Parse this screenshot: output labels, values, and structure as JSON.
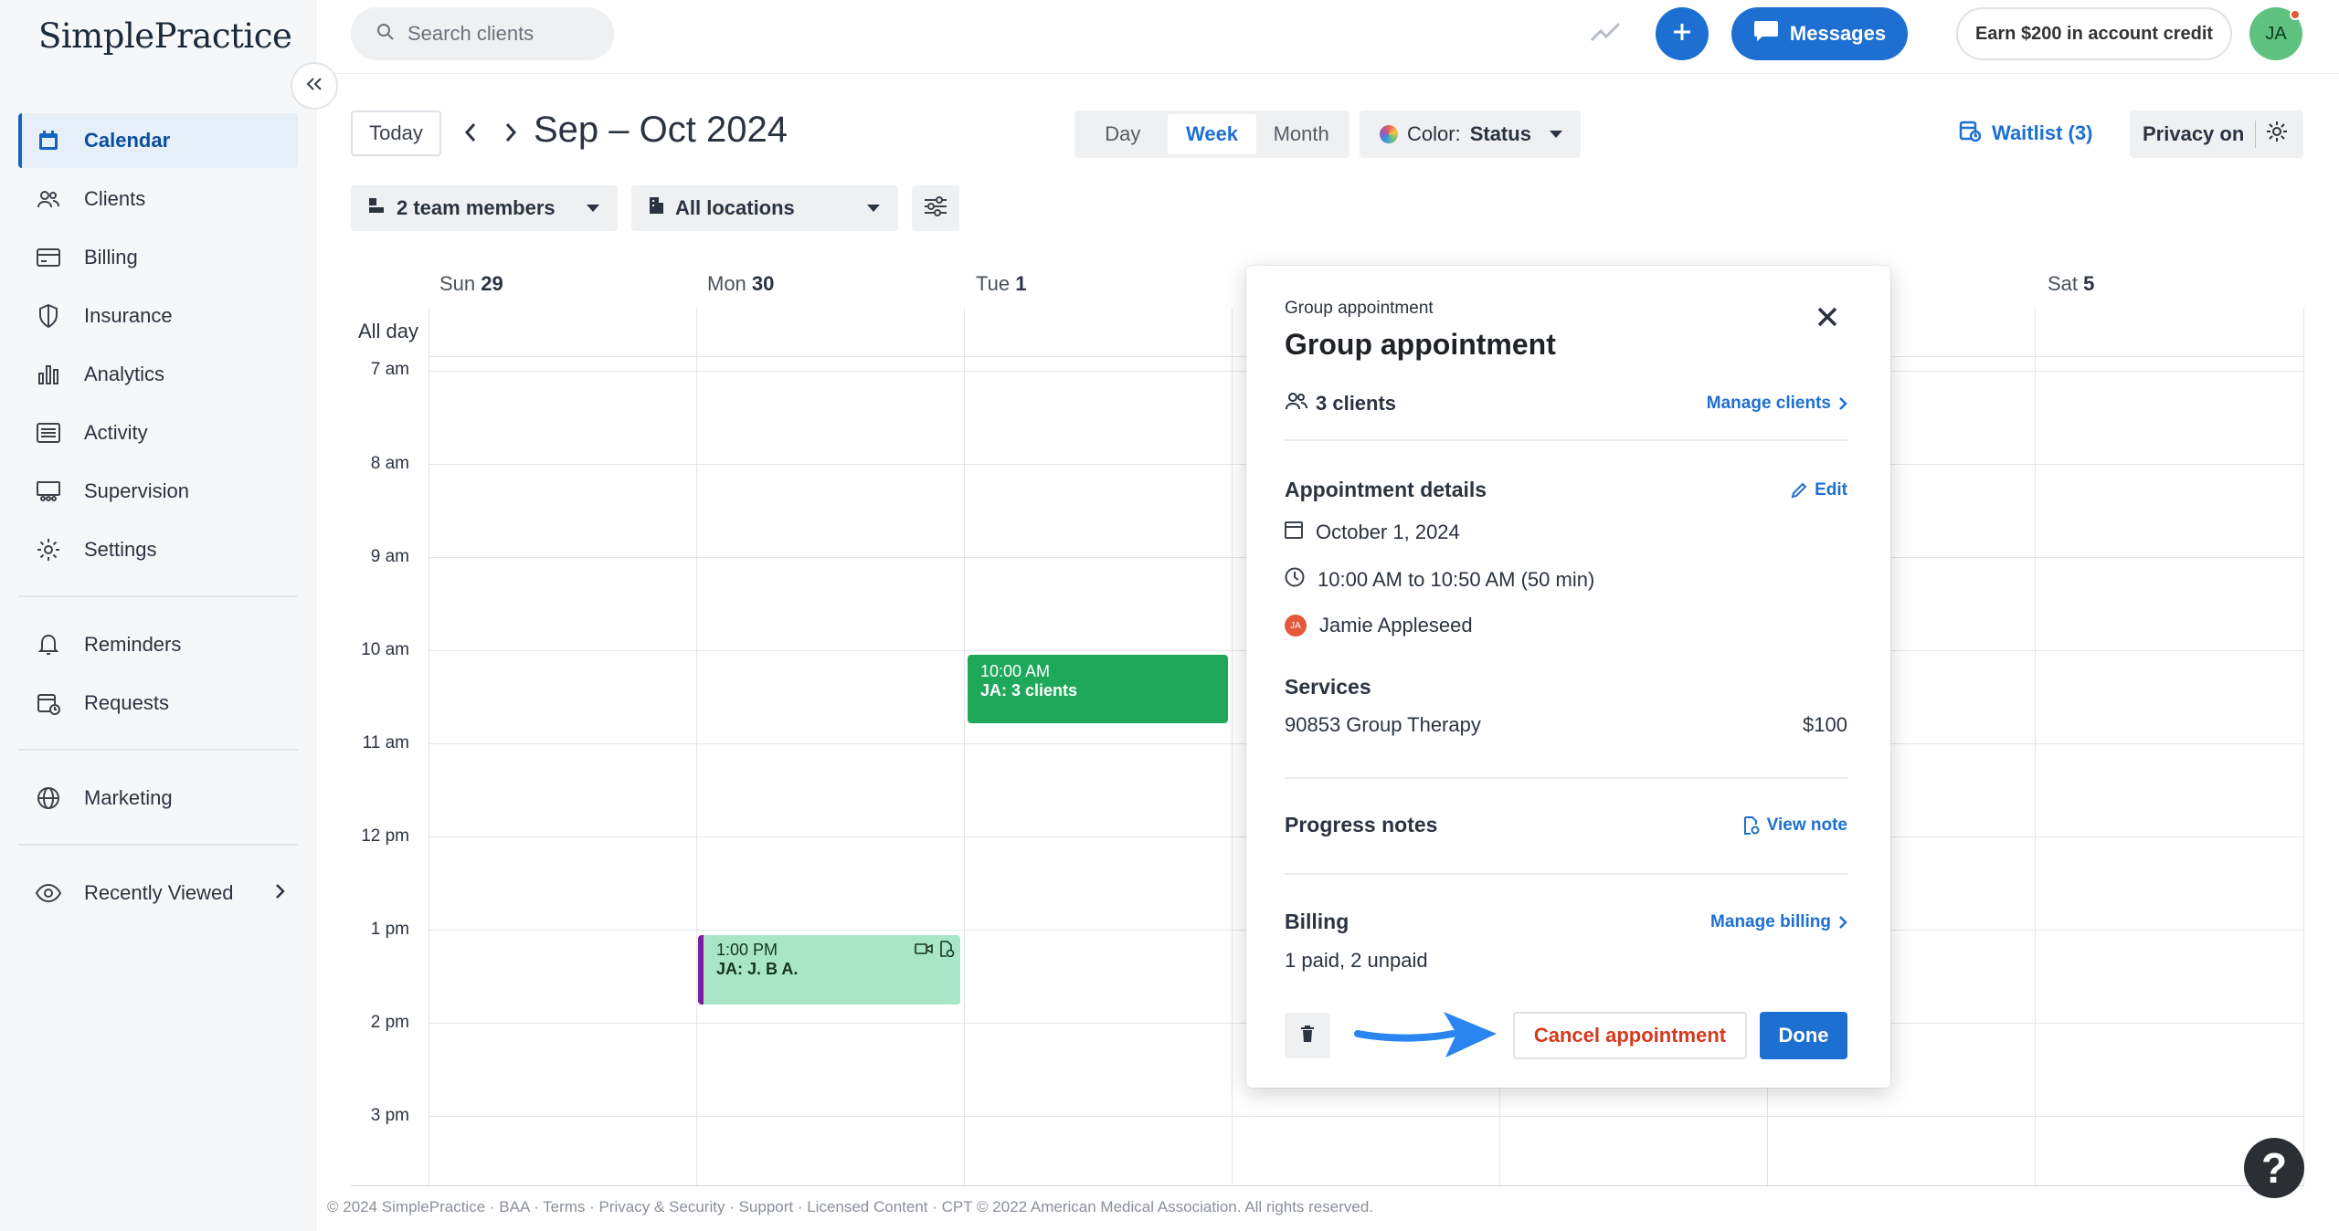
{
  "app": {
    "logo": "SimplePractice"
  },
  "sidebar": {
    "items": [
      {
        "label": "Calendar",
        "icon": "calendar-icon"
      },
      {
        "label": "Clients",
        "icon": "clients-icon"
      },
      {
        "label": "Billing",
        "icon": "billing-icon"
      },
      {
        "label": "Insurance",
        "icon": "shield-icon"
      },
      {
        "label": "Analytics",
        "icon": "bar-chart-icon"
      },
      {
        "label": "Activity",
        "icon": "list-icon"
      },
      {
        "label": "Supervision",
        "icon": "supervision-icon"
      },
      {
        "label": "Settings",
        "icon": "gear-icon"
      },
      {
        "label": "Reminders",
        "icon": "bell-icon"
      },
      {
        "label": "Requests",
        "icon": "calendar-request-icon"
      },
      {
        "label": "Marketing",
        "icon": "globe-icon"
      },
      {
        "label": "Recently Viewed",
        "icon": "eye-icon"
      }
    ]
  },
  "header": {
    "search_placeholder": "Search clients",
    "messages_label": "Messages",
    "credit_label": "Earn $200 in account credit",
    "avatar_initials": "JA"
  },
  "toolbar": {
    "today_label": "Today",
    "range_title": "Sep – Oct 2024",
    "views": [
      "Day",
      "Week",
      "Month"
    ],
    "selected_view": "Week",
    "color_prefix": "Color:",
    "color_value": "Status",
    "waitlist_label": "Waitlist (3)",
    "privacy_label": "Privacy on",
    "team_label": "2 team members",
    "location_label": "All locations"
  },
  "calendar": {
    "days": [
      {
        "name": "Sun",
        "num": "29"
      },
      {
        "name": "Mon",
        "num": "30"
      },
      {
        "name": "Tue",
        "num": "1"
      },
      {
        "name": "Sat",
        "num": "5"
      }
    ],
    "allday_label": "All day",
    "times": [
      "7 am",
      "8 am",
      "9 am",
      "10 am",
      "11 am",
      "12 pm",
      "1 pm",
      "2 pm",
      "3 pm"
    ],
    "appointments": [
      {
        "time": "10:00 AM",
        "title": "JA: 3 clients"
      },
      {
        "time": "1:00 PM",
        "title": "JA: J. B A."
      }
    ]
  },
  "popover": {
    "kicker": "Group appointment",
    "title": "Group appointment",
    "clients_label": "3 clients",
    "manage_clients": "Manage clients",
    "details_heading": "Appointment details",
    "edit_label": "Edit",
    "date": "October 1, 2024",
    "time": "10:00 AM to 10:50 AM (50 min)",
    "clinician_initials": "JA",
    "clinician": "Jamie Appleseed",
    "services_heading": "Services",
    "service_name": "90853 Group Therapy",
    "service_price": "$100",
    "notes_heading": "Progress notes",
    "view_note": "View note",
    "billing_heading": "Billing",
    "manage_billing": "Manage billing",
    "billing_status": "1 paid, 2 unpaid",
    "cancel_label": "Cancel appointment",
    "done_label": "Done"
  },
  "footer": {
    "text": "© 2024 SimplePractice · BAA · Terms · Privacy & Security · Support · Licensed Content · CPT © 2022 American Medical Association. All rights reserved."
  },
  "help": {
    "label": "?"
  },
  "colors": {
    "accent": "#1d6fd1",
    "appt_green": "#1fa85a",
    "appt_mint": "#a9e6c7",
    "danger": "#d33a1e"
  }
}
